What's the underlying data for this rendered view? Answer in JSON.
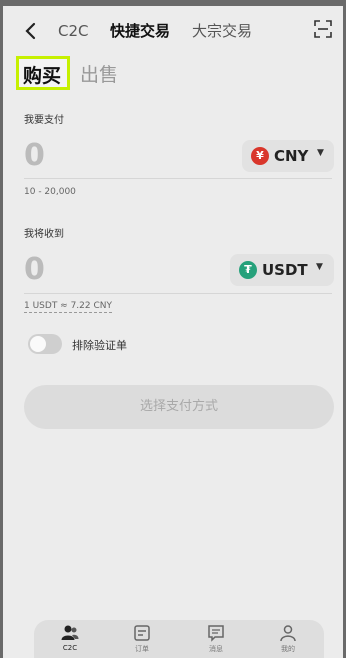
{
  "header": {
    "tabs": [
      "C2C",
      "快捷交易",
      "大宗交易"
    ]
  },
  "trade_tabs": {
    "buy": "购买",
    "sell": "出售"
  },
  "pay": {
    "label": "我要支付",
    "value": "0",
    "currency": "CNY",
    "currency_symbol": "¥",
    "range": "10 - 20,000"
  },
  "receive": {
    "label": "我将收到",
    "value": "0",
    "currency": "USDT",
    "currency_symbol": "₮"
  },
  "rate": "1 USDT ≈ 7.22 CNY",
  "toggle": {
    "label": "排除验证单",
    "on": false
  },
  "action_button": "选择支付方式",
  "bottom_nav": [
    "C2C",
    "订单",
    "消息",
    "我的"
  ],
  "colors": {
    "highlight": "#c6f000",
    "cny": "#d9362b",
    "usdt": "#26a17b"
  }
}
